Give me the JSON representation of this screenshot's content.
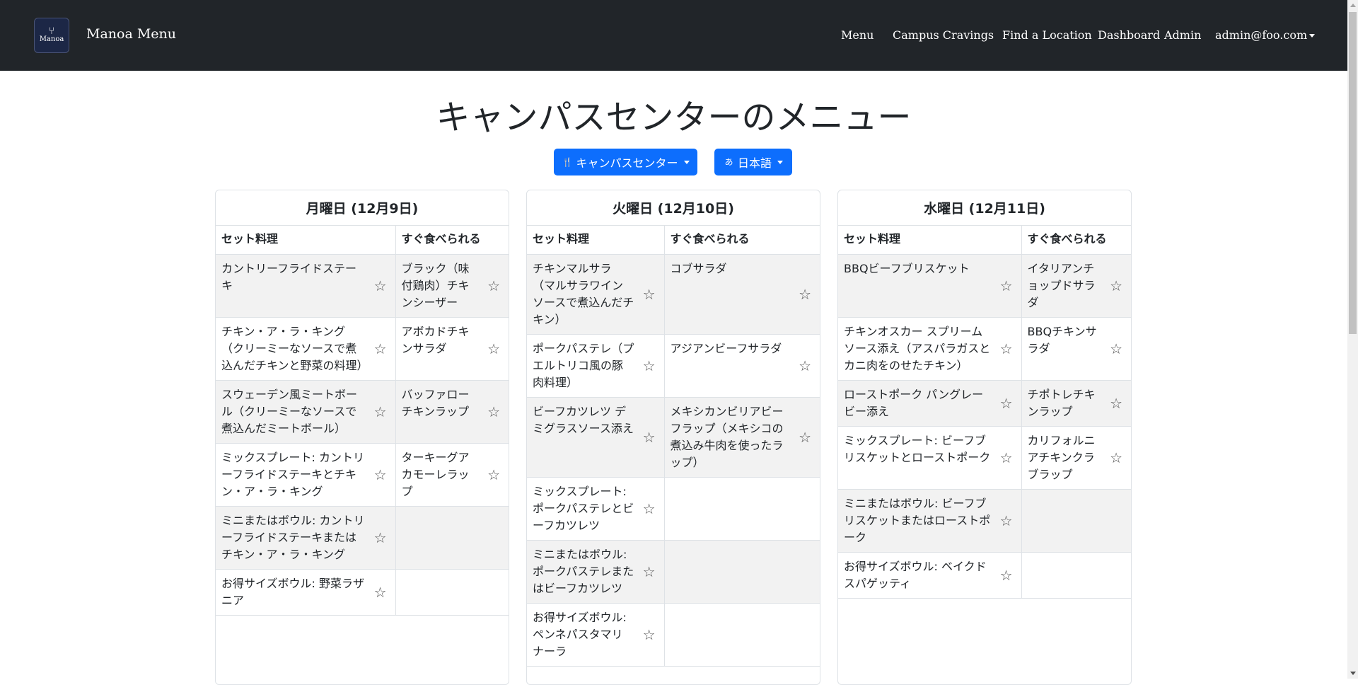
{
  "navbar": {
    "logo_text": "Manoa",
    "brand": "Manoa Menu",
    "links": [
      "Menu",
      "Campus Cravings",
      "Find a Location",
      "Dashboard",
      "Admin"
    ],
    "user": "admin@foo.com"
  },
  "page_title": "キャンパスセンターのメニュー",
  "location_button": "キャンパスセンター",
  "language_button": "日本語",
  "days": [
    {
      "header": "月曜日 (12月9日)",
      "col1": "セット料理",
      "col2": "すぐ食べられる",
      "rows": [
        [
          "カントリーフライドステーキ",
          "ブラック（味付鶏肉）チキンシーザー"
        ],
        [
          "チキン・ア・ラ・キング（クリーミーなソースで煮込んだチキンと野菜の料理）",
          "アボカドチキンサラダ"
        ],
        [
          "スウェーデン風ミートボール（クリーミーなソースで煮込んだミートボール）",
          "バッファローチキンラップ"
        ],
        [
          "ミックスプレート: カントリーフライドステーキとチキン・ア・ラ・キング",
          "ターキーグアカモーレラップ"
        ],
        [
          "ミニまたはボウル: カントリーフライドステーキまたはチキン・ア・ラ・キング",
          ""
        ],
        [
          "お得サイズボウル: 野菜ラザニア",
          ""
        ]
      ]
    },
    {
      "header": "火曜日 (12月10日)",
      "col1": "セット料理",
      "col2": "すぐ食べられる",
      "rows": [
        [
          "チキンマルサラ（マルサラワインソースで煮込んだチキン）",
          "コブサラダ"
        ],
        [
          "ポークパステレ（プエルトリコ風の豚肉料理）",
          "アジアンビーフサラダ"
        ],
        [
          "ビーフカツレツ デミグラスソース添え",
          "メキシカンビリアビーフラップ（メキシコの煮込み牛肉を使ったラップ）"
        ],
        [
          "ミックスプレート: ポークパステレとビーフカツレツ",
          ""
        ],
        [
          "ミニまたはボウル: ポークパステレまたはビーフカツレツ",
          ""
        ],
        [
          "お得サイズボウル: ペンネパスタマリナーラ",
          ""
        ]
      ]
    },
    {
      "header": "水曜日 (12月11日)",
      "col1": "セット料理",
      "col2": "すぐ食べられる",
      "rows": [
        [
          "BBQビーフブリスケット",
          "イタリアンチョップドサラダ"
        ],
        [
          "チキンオスカー スプリームソース添え（アスパラガスとカニ肉をのせたチキン）",
          "BBQチキンサラダ"
        ],
        [
          "ローストポーク パングレービー添え",
          "チポトレチキンラップ"
        ],
        [
          "ミックスプレート: ビーフブリスケットとローストポーク",
          "カリフォルニアチキンクラブラップ"
        ],
        [
          "ミニまたはボウル: ビーフブリスケットまたはローストポーク",
          ""
        ],
        [
          "お得サイズボウル: ベイクドスパゲッティ",
          ""
        ]
      ]
    }
  ],
  "icons": {
    "favorite": "star-outline-icon",
    "location": "utensils-icon",
    "language": "translate-icon"
  },
  "colors": {
    "navbar": "#212529",
    "primary_button": "#0d6efd",
    "striped_row": "#f2f2f2"
  }
}
